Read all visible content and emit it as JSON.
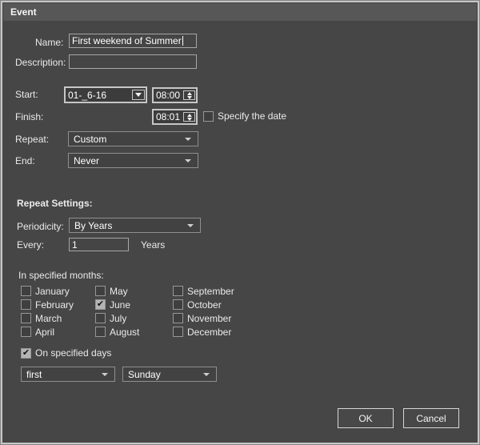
{
  "window": {
    "title": "Event"
  },
  "colors": {
    "dialog_bg": "#464646",
    "titlebar_bg": "#575757",
    "text": "#eaeaea",
    "checked_fill": "#b4b4b4"
  },
  "form": {
    "name": {
      "label": "Name:",
      "value": "First weekend of Summer"
    },
    "description": {
      "label": "Description:",
      "value": ""
    },
    "start": {
      "label": "Start:",
      "date_value": "01-_6-16",
      "time_value": "08:00"
    },
    "finish": {
      "label": "Finish:",
      "time_value": "08:01",
      "specify_date": {
        "label": "Specify the date",
        "checked": false,
        "check_glyph": "✔"
      }
    },
    "repeat": {
      "label": "Repeat:",
      "value": "Custom"
    },
    "end": {
      "label": "End:",
      "value": "Never"
    }
  },
  "repeat_settings": {
    "heading": "Repeat Settings:",
    "periodicity": {
      "label": "Periodicity:",
      "value": "By Years"
    },
    "every": {
      "label": "Every:",
      "value": "1",
      "unit": "Years"
    },
    "months": {
      "heading": "In specified months:",
      "check_glyph": "✔",
      "items": [
        {
          "label": "January",
          "checked": false
        },
        {
          "label": "February",
          "checked": false
        },
        {
          "label": "March",
          "checked": false
        },
        {
          "label": "April",
          "checked": false
        },
        {
          "label": "May",
          "checked": false
        },
        {
          "label": "June",
          "checked": true
        },
        {
          "label": "July",
          "checked": false
        },
        {
          "label": "August",
          "checked": false
        },
        {
          "label": "September",
          "checked": false
        },
        {
          "label": "October",
          "checked": false
        },
        {
          "label": "November",
          "checked": false
        },
        {
          "label": "December",
          "checked": false
        }
      ]
    },
    "on_specified_days": {
      "label": "On specified days",
      "checked": true,
      "check_glyph": "✔"
    },
    "day_ordinal": {
      "value": "first"
    },
    "day_name": {
      "value": "Sunday"
    }
  },
  "buttons": {
    "ok": "OK",
    "cancel": "Cancel"
  }
}
